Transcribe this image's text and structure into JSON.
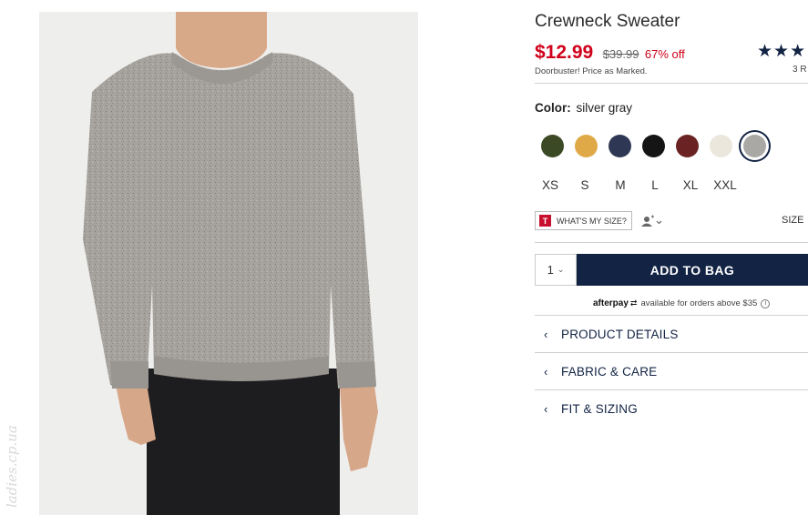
{
  "product": {
    "title": "Crewneck Sweater",
    "sale_price": "$12.99",
    "original_price": "$39.99",
    "discount": "67% off",
    "promo_note": "Doorbuster! Price as Marked.",
    "rating_stars": "★★★",
    "reviews_text": "3 R"
  },
  "color": {
    "label": "Color:",
    "selected": "silver gray",
    "swatches": [
      {
        "name": "olive",
        "hex": "#3b4a25"
      },
      {
        "name": "mustard",
        "hex": "#e0a948"
      },
      {
        "name": "navy",
        "hex": "#2e3754"
      },
      {
        "name": "black",
        "hex": "#151515"
      },
      {
        "name": "burgundy",
        "hex": "#6a2322"
      },
      {
        "name": "cream",
        "hex": "#ebe7dd"
      },
      {
        "name": "silver gray",
        "hex": "#a9a8a5",
        "selected": true
      }
    ]
  },
  "sizes": [
    "XS",
    "S",
    "M",
    "L",
    "XL",
    "XXL"
  ],
  "fit": {
    "badge": "T",
    "button_label": "WHAT'S MY SIZE?",
    "size_guide": "SIZE"
  },
  "cart": {
    "quantity": "1",
    "add_label": "ADD TO BAG"
  },
  "afterpay": {
    "logo": "afterpay",
    "text": "available for orders above $35",
    "info": "i"
  },
  "accordion": [
    {
      "label": "PRODUCT DETAILS"
    },
    {
      "label": "FABRIC & CARE"
    },
    {
      "label": "FIT & SIZING"
    }
  ],
  "watermark": "ladies.cp.ua",
  "colors": {
    "accent_navy": "#122344",
    "sale_red": "#d0021b"
  }
}
